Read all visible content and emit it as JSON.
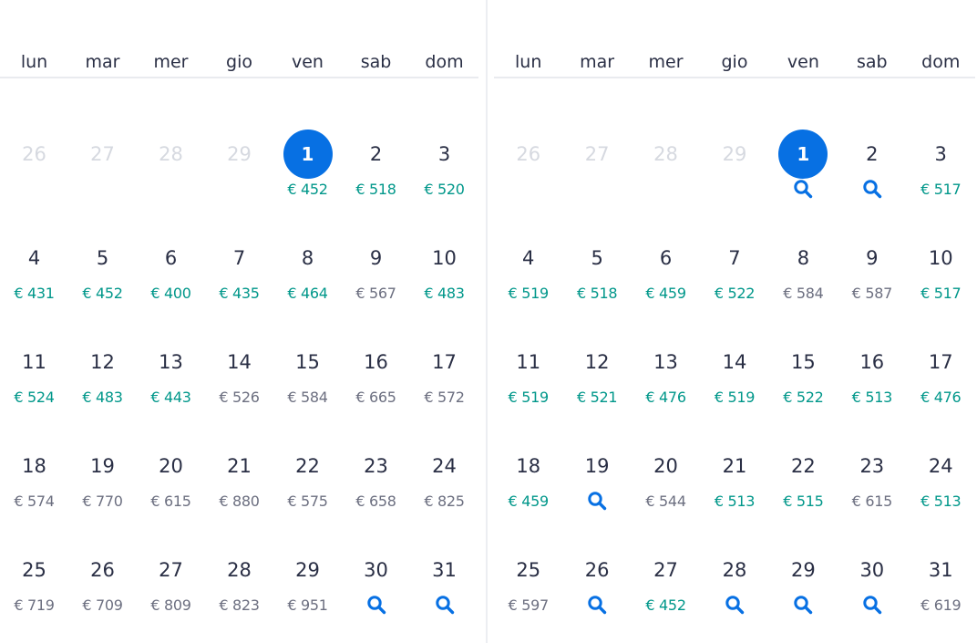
{
  "weekdays": [
    "lun",
    "mar",
    "mer",
    "gio",
    "ven",
    "sab",
    "dom"
  ],
  "colors": {
    "accent": "#0770e3",
    "cheap": "#00978a",
    "normal": "#6c6f80"
  },
  "months": [
    {
      "weeks": [
        [
          {
            "d": "26",
            "other": true
          },
          {
            "d": "27",
            "other": true
          },
          {
            "d": "28",
            "other": true
          },
          {
            "d": "29",
            "other": true
          },
          {
            "d": "1",
            "selected": true,
            "p": "€ 452",
            "c": "cheap"
          },
          {
            "d": "2",
            "p": "€ 518",
            "c": "cheap"
          },
          {
            "d": "3",
            "p": "€ 520",
            "c": "cheap"
          }
        ],
        [
          {
            "d": "4",
            "p": "€ 431",
            "c": "cheap"
          },
          {
            "d": "5",
            "p": "€ 452",
            "c": "cheap"
          },
          {
            "d": "6",
            "p": "€ 400",
            "c": "cheap"
          },
          {
            "d": "7",
            "p": "€ 435",
            "c": "cheap"
          },
          {
            "d": "8",
            "p": "€ 464",
            "c": "cheap"
          },
          {
            "d": "9",
            "p": "€ 567",
            "c": "normal"
          },
          {
            "d": "10",
            "p": "€ 483",
            "c": "cheap"
          }
        ],
        [
          {
            "d": "11",
            "p": "€ 524",
            "c": "cheap"
          },
          {
            "d": "12",
            "p": "€ 483",
            "c": "cheap"
          },
          {
            "d": "13",
            "p": "€ 443",
            "c": "cheap"
          },
          {
            "d": "14",
            "p": "€ 526",
            "c": "normal"
          },
          {
            "d": "15",
            "p": "€ 584",
            "c": "normal"
          },
          {
            "d": "16",
            "p": "€ 665",
            "c": "normal"
          },
          {
            "d": "17",
            "p": "€ 572",
            "c": "normal"
          }
        ],
        [
          {
            "d": "18",
            "p": "€ 574",
            "c": "normal"
          },
          {
            "d": "19",
            "p": "€ 770",
            "c": "normal"
          },
          {
            "d": "20",
            "p": "€ 615",
            "c": "normal"
          },
          {
            "d": "21",
            "p": "€ 880",
            "c": "normal"
          },
          {
            "d": "22",
            "p": "€ 575",
            "c": "normal"
          },
          {
            "d": "23",
            "p": "€ 658",
            "c": "normal"
          },
          {
            "d": "24",
            "p": "€ 825",
            "c": "normal"
          }
        ],
        [
          {
            "d": "25",
            "p": "€ 719",
            "c": "normal"
          },
          {
            "d": "26",
            "p": "€ 709",
            "c": "normal"
          },
          {
            "d": "27",
            "p": "€ 809",
            "c": "normal"
          },
          {
            "d": "28",
            "p": "€ 823",
            "c": "normal"
          },
          {
            "d": "29",
            "p": "€ 951",
            "c": "normal"
          },
          {
            "d": "30",
            "icon": "search-icon"
          },
          {
            "d": "31",
            "icon": "search-icon"
          }
        ]
      ]
    },
    {
      "weeks": [
        [
          {
            "d": "26",
            "other": true
          },
          {
            "d": "27",
            "other": true
          },
          {
            "d": "28",
            "other": true
          },
          {
            "d": "29",
            "other": true
          },
          {
            "d": "1",
            "selected": true,
            "icon": "search-icon"
          },
          {
            "d": "2",
            "icon": "search-icon"
          },
          {
            "d": "3",
            "p": "€ 517",
            "c": "cheap"
          }
        ],
        [
          {
            "d": "4",
            "p": "€ 519",
            "c": "cheap"
          },
          {
            "d": "5",
            "p": "€ 518",
            "c": "cheap"
          },
          {
            "d": "6",
            "p": "€ 459",
            "c": "cheap"
          },
          {
            "d": "7",
            "p": "€ 522",
            "c": "cheap"
          },
          {
            "d": "8",
            "p": "€ 584",
            "c": "normal"
          },
          {
            "d": "9",
            "p": "€ 587",
            "c": "normal"
          },
          {
            "d": "10",
            "p": "€ 517",
            "c": "cheap"
          }
        ],
        [
          {
            "d": "11",
            "p": "€ 519",
            "c": "cheap"
          },
          {
            "d": "12",
            "p": "€ 521",
            "c": "cheap"
          },
          {
            "d": "13",
            "p": "€ 476",
            "c": "cheap"
          },
          {
            "d": "14",
            "p": "€ 519",
            "c": "cheap"
          },
          {
            "d": "15",
            "p": "€ 522",
            "c": "cheap"
          },
          {
            "d": "16",
            "p": "€ 513",
            "c": "cheap"
          },
          {
            "d": "17",
            "p": "€ 476",
            "c": "cheap"
          }
        ],
        [
          {
            "d": "18",
            "p": "€ 459",
            "c": "cheap"
          },
          {
            "d": "19",
            "icon": "search-icon"
          },
          {
            "d": "20",
            "p": "€ 544",
            "c": "normal"
          },
          {
            "d": "21",
            "p": "€ 513",
            "c": "cheap"
          },
          {
            "d": "22",
            "p": "€ 515",
            "c": "cheap"
          },
          {
            "d": "23",
            "p": "€ 615",
            "c": "normal"
          },
          {
            "d": "24",
            "p": "€ 513",
            "c": "cheap"
          }
        ],
        [
          {
            "d": "25",
            "p": "€ 597",
            "c": "normal"
          },
          {
            "d": "26",
            "icon": "search-icon"
          },
          {
            "d": "27",
            "p": "€ 452",
            "c": "cheap"
          },
          {
            "d": "28",
            "icon": "search-icon"
          },
          {
            "d": "29",
            "icon": "search-icon"
          },
          {
            "d": "30",
            "icon": "search-icon"
          },
          {
            "d": "31",
            "p": "€ 619",
            "c": "normal"
          }
        ]
      ]
    }
  ]
}
